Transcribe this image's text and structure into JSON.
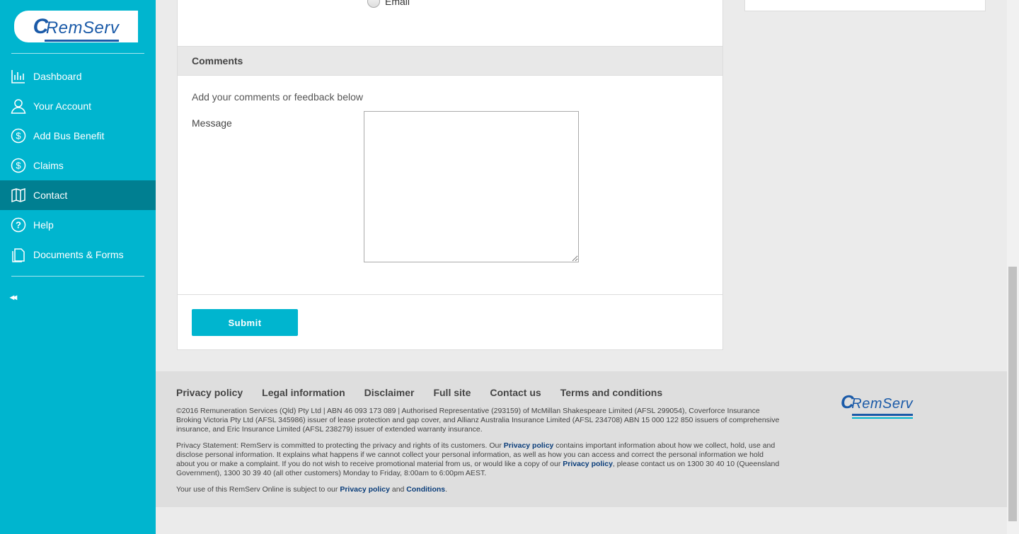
{
  "brand": {
    "logo_text": "RemServ",
    "logo_initial": "C"
  },
  "sidebar": {
    "items": [
      {
        "label": "Dashboard",
        "icon": "chart-icon"
      },
      {
        "label": "Your Account",
        "icon": "user-icon"
      },
      {
        "label": "Add Bus Benefit",
        "icon": "dollar-icon"
      },
      {
        "label": "Claims",
        "icon": "dollar-icon"
      },
      {
        "label": "Contact",
        "icon": "map-icon",
        "active": true
      },
      {
        "label": "Help",
        "icon": "question-icon"
      },
      {
        "label": "Documents & Forms",
        "icon": "document-icon"
      }
    ],
    "collapse_label": "◂◂"
  },
  "form": {
    "radio_email_label": "Email",
    "comments_heading": "Comments",
    "intro": "Add your comments or feedback below",
    "message_label": "Message",
    "message_value": "",
    "submit_label": "Submit"
  },
  "footer": {
    "links": [
      "Privacy policy",
      "Legal information",
      "Disclaimer",
      "Full site",
      "Contact us",
      "Terms and conditions"
    ],
    "copyright": "©2016 Remuneration Services (Qld) Pty Ltd | ABN 46 093 173 089 | Authorised Representative (293159) of McMillan Shakespeare Limited (AFSL 299054), Coverforce Insurance Broking Victoria Pty Ltd (AFSL 345986) issuer of lease protection and gap cover,  and Allianz Australia Insurance Limited (AFSL 234708) ABN 15 000 122 850 issuers of comprehensive insurance, and Eric Insurance Limited (AFSL 238279) issuer of extended warranty insurance.",
    "privacy_part1": "Privacy Statement: RemServ is committed to protecting the privacy and rights of its customers. Our ",
    "privacy_link1": "Privacy policy",
    "privacy_part2": " contains important information about how we collect, hold, use and disclose personal information. It explains what happens if we cannot collect your personal information, as well as how you can access and correct the personal information we hold about you or make a complaint. If you do not wish to receive promotional material from us, or would like a copy of our ",
    "privacy_link2": "Privacy policy",
    "privacy_part3": ", please contact us on 1300 30 40 10 (Queensland Government), 1300 30 39 40 (all other customers) Monday to Friday, 8:00am to 6:00pm AEST.",
    "use_part1": "Your use of this RemServ Online is subject to our ",
    "use_link1": "Privacy policy",
    "use_part2": " and ",
    "use_link2": "Conditions",
    "use_part3": "."
  }
}
